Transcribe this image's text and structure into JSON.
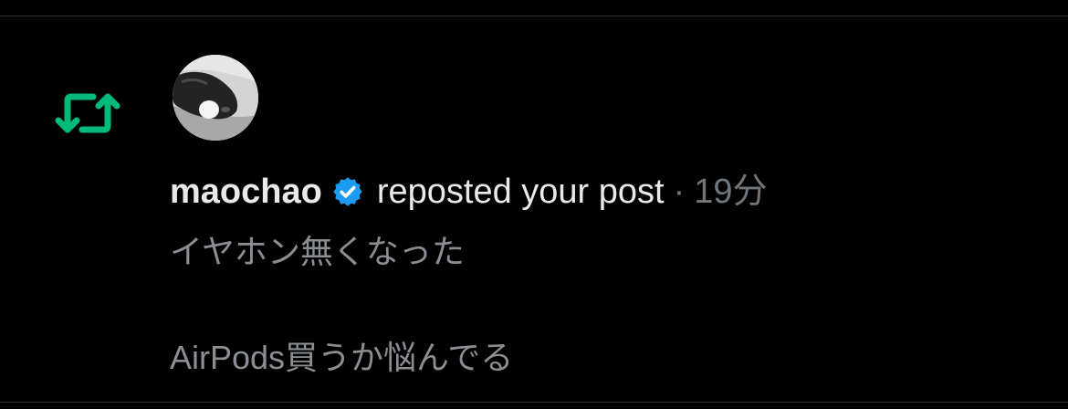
{
  "notification": {
    "type_icon": "repost-icon",
    "avatar_icon": "cat-avatar",
    "username": "maochao",
    "verified_icon": "verified-badge-icon",
    "action_text": "reposted your post",
    "separator": "·",
    "time": "19分",
    "post_lines": [
      "イヤホン無くなった",
      "",
      "AirPods買うか悩んでる"
    ]
  },
  "colors": {
    "background": "#000000",
    "divider": "#2f3336",
    "repost_green": "#00ba7c",
    "verified_blue": "#1d9bf0",
    "primary_text": "#e7e9ea",
    "secondary_text": "#71767b"
  }
}
